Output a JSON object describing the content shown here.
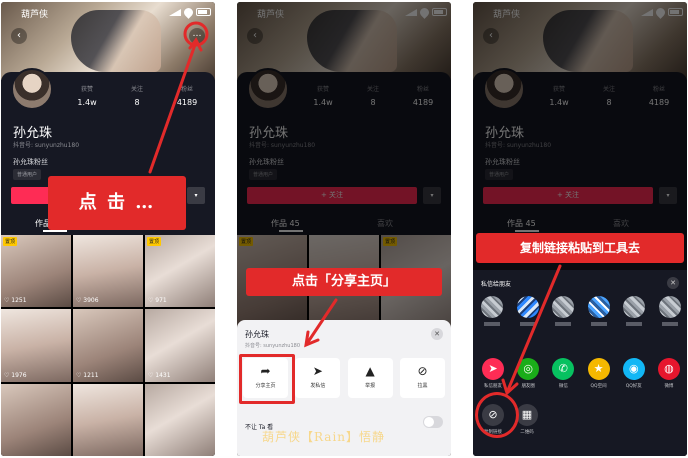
{
  "status": {
    "app_name": "葫芦侠"
  },
  "profile": {
    "name": "孙允珠",
    "account_id": "抖音号: sunyunzhu180",
    "stats": [
      {
        "label": "获赞",
        "value": "1.4w"
      },
      {
        "label": "关注",
        "value": "8"
      },
      {
        "label": "粉丝",
        "value": "4189"
      }
    ],
    "fans_group": "孙允珠粉丝",
    "tag": "普通用户",
    "follow_label": "+ 关注",
    "dropdown_icon": "▾",
    "tabs": [
      "作品 45",
      "喜欢"
    ]
  },
  "videos": [
    {
      "pinned": "置顶",
      "likes": "♡ 1251"
    },
    {
      "pinned": "",
      "likes": "♡ 3906"
    },
    {
      "pinned": "置顶",
      "likes": "♡ 971"
    },
    {
      "pinned": "",
      "likes": "♡ 1976"
    },
    {
      "pinned": "",
      "likes": "♡ 1211"
    },
    {
      "pinned": "",
      "likes": "♡ 1431"
    },
    {
      "pinned": "",
      "likes": ""
    },
    {
      "pinned": "",
      "likes": ""
    },
    {
      "pinned": "",
      "likes": ""
    }
  ],
  "callouts": {
    "step1": "点 击 …",
    "step2": "点击「分享主页」",
    "step3": "复制链接粘贴到工具去"
  },
  "share_sheet": {
    "name": "孙允珠",
    "account_id": "抖音号: sunyunzhu180",
    "actions": [
      {
        "icon": "share-arrow-icon",
        "glyph": "➦",
        "label": "分享主页"
      },
      {
        "icon": "send-icon",
        "glyph": "➤",
        "label": "发私信"
      },
      {
        "icon": "warning-icon",
        "glyph": "▲",
        "label": "举报"
      },
      {
        "icon": "block-icon",
        "glyph": "⊘",
        "label": "拉黑"
      }
    ],
    "toggle_label": "不让 Ta 看"
  },
  "watermark": "葫芦侠【Rain】悟静",
  "share_panel": {
    "header": "私信给朋友",
    "targets": [
      {
        "label": "私信朋友",
        "color": "#fe2c55",
        "glyph": "➤"
      },
      {
        "label": "朋友圈",
        "color": "#1aad19",
        "glyph": "◎"
      },
      {
        "label": "微信",
        "color": "#07c160",
        "glyph": "✆"
      },
      {
        "label": "QQ空间",
        "color": "#f5b800",
        "glyph": "★"
      },
      {
        "label": "QQ好友",
        "color": "#12b7f5",
        "glyph": "◉"
      },
      {
        "label": "微博",
        "color": "#e6162d",
        "glyph": "◍"
      }
    ],
    "tools": [
      {
        "label": "复制链接",
        "glyph": "⊘"
      },
      {
        "label": "二维码",
        "glyph": "▦"
      }
    ]
  },
  "colors": {
    "brand_red": "#fe2c55",
    "callout_red": "#e22a2a",
    "bg_dark": "#161823"
  }
}
